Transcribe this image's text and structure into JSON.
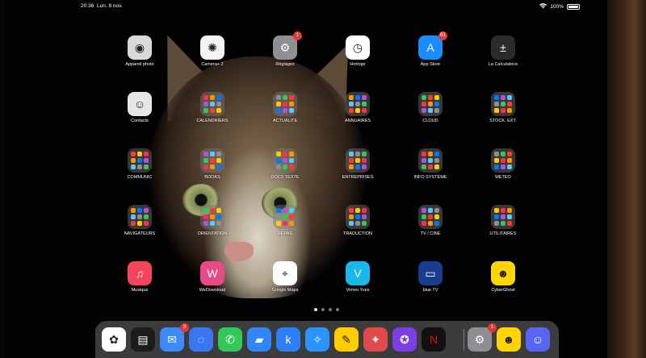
{
  "status_bar": {
    "time": "20:36",
    "date": "Lun. 8 nov.",
    "battery": "100%"
  },
  "apps": [
    {
      "label": "Appareil photo",
      "icon": "camera-icon",
      "color": "#d9d9d9"
    },
    {
      "label": "Camera+ 2",
      "icon": "camera-plus-icon",
      "color": "#f3f3f3"
    },
    {
      "label": "Réglages",
      "icon": "gear-icon",
      "color": "#8e8e93",
      "badge": "1"
    },
    {
      "label": "Horloge",
      "icon": "clock-icon",
      "color": "#ffffff"
    },
    {
      "label": "App Store",
      "icon": "app-store-icon",
      "color": "#1a8cff",
      "badge": "61"
    },
    {
      "label": "La Calculatrice",
      "icon": "calculator-icon",
      "color": "#2b2b2b"
    },
    {
      "label": "Contacts",
      "icon": "contacts-icon",
      "color": "#e6e6e6"
    },
    {
      "label": "CALENDRIERS",
      "folder": true
    },
    {
      "label": "ACTUALITE",
      "folder": true
    },
    {
      "label": "ANNUAIRES",
      "folder": true
    },
    {
      "label": "CLOUD",
      "folder": true
    },
    {
      "label": "STOCK. EXT.",
      "folder": true
    },
    {
      "label": "COMMUNIC",
      "folder": true
    },
    {
      "label": "BOOKS",
      "folder": true
    },
    {
      "label": "DOCS TEXTE",
      "folder": true
    },
    {
      "label": "ENTREPRISES",
      "folder": true
    },
    {
      "label": "INFO SYSTÈME",
      "folder": true
    },
    {
      "label": "METEO",
      "folder": true
    },
    {
      "label": "NAVIGATEURS",
      "folder": true
    },
    {
      "label": "ORIENTATION",
      "folder": true
    },
    {
      "label": "REPAS",
      "folder": true
    },
    {
      "label": "TRADUCTION",
      "folder": true
    },
    {
      "label": "TV / CINE",
      "folder": true
    },
    {
      "label": "UTILITAIRES",
      "folder": true
    },
    {
      "label": "Musique",
      "icon": "music-icon",
      "color": "#f4455a"
    },
    {
      "label": "WeDownload",
      "icon": "wedownload-icon",
      "color": "#e74a86"
    },
    {
      "label": "Google Maps",
      "icon": "maps-pin-icon",
      "color": "#ffffff"
    },
    {
      "label": "Vimeo Yves",
      "icon": "vimeo-icon",
      "color": "#1ab7ea"
    },
    {
      "label": "blue TV",
      "icon": "tv-icon",
      "color": "#1a3d8f"
    },
    {
      "label": "CyberGhost",
      "icon": "ghost-icon",
      "color": "#ffd400"
    }
  ],
  "page_dots": {
    "count": 4,
    "active": 1
  },
  "dock": [
    {
      "name": "photos-icon",
      "color": "#ffffff"
    },
    {
      "name": "wallet-icon",
      "color": "#1c1c1e"
    },
    {
      "name": "mail-icon",
      "color": "#3d8bf6",
      "badge": "3"
    },
    {
      "name": "signal-icon",
      "color": "#3a76f0"
    },
    {
      "name": "messages-icon",
      "color": "#34c759"
    },
    {
      "name": "files-icon",
      "color": "#2f86f5"
    },
    {
      "name": "keynote-icon",
      "color": "#2d7ff9"
    },
    {
      "name": "safari-icon",
      "color": "#2a94ff"
    },
    {
      "name": "goodnotes-icon",
      "color": "#ffcc00"
    },
    {
      "name": "pinterest-icon",
      "color": "#e14a4a"
    },
    {
      "name": "games-icon",
      "color": "#7b3fe4"
    },
    {
      "name": "netflix-icon",
      "color": "#111111"
    },
    {
      "name": "settings-icon",
      "color": "#8e8e93",
      "badge": "1"
    },
    {
      "name": "cyberghost-dock-icon",
      "color": "#ffd400"
    },
    {
      "name": "discord-icon",
      "color": "#5865f2"
    }
  ]
}
